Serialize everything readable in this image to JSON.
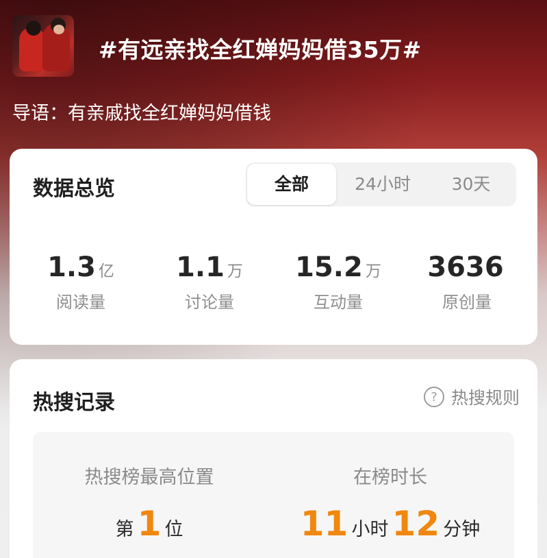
{
  "header": {
    "title": "#有远亲找全红婵妈妈借35万#",
    "lead": "导语：有亲戚找全红婵妈妈借钱"
  },
  "overview": {
    "title": "数据总览",
    "tabs": [
      "全部",
      "24小时",
      "30天"
    ],
    "active_tab": "全部",
    "stats": [
      {
        "value": "1.3",
        "unit": "亿",
        "label": "阅读量"
      },
      {
        "value": "1.1",
        "unit": "万",
        "label": "讨论量"
      },
      {
        "value": "15.2",
        "unit": "万",
        "label": "互动量"
      },
      {
        "value": "3636",
        "unit": "",
        "label": "原创量"
      }
    ]
  },
  "hot": {
    "title": "热搜记录",
    "rules_label": "热搜规则",
    "rules_icon": "question-circle-icon",
    "peak": {
      "title": "热搜榜最高位置",
      "prefix": "第",
      "value": "1",
      "suffix": "位"
    },
    "duration": {
      "title": "在榜时长",
      "hours": "11",
      "hours_unit": "小时",
      "minutes": "12",
      "minutes_unit": "分钟"
    }
  },
  "colors": {
    "accent": "#f0870e",
    "header_red": "#8a1e1f"
  }
}
